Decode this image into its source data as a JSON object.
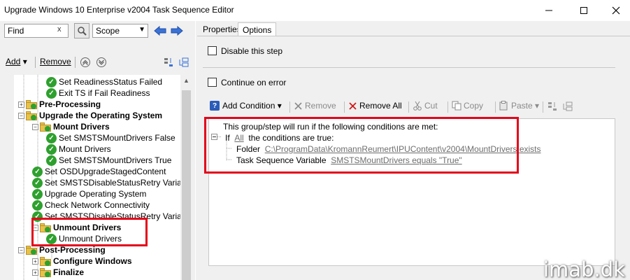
{
  "window": {
    "title": "Upgrade Windows 10 Enterprise v2004 Task Sequence Editor"
  },
  "search": {
    "value": "Find",
    "clear": "x",
    "scope": "Scope"
  },
  "tree_toolbar": {
    "add": "Add",
    "remove": "Remove"
  },
  "tree": [
    {
      "label": "Set ReadinessStatus Failed",
      "type": "step"
    },
    {
      "label": "Exit TS if Fail Readiness",
      "type": "step"
    },
    {
      "label": "Pre-Processing",
      "type": "group",
      "exp": "+"
    },
    {
      "label": "Upgrade the Operating System",
      "type": "group",
      "exp": "−"
    },
    {
      "label": "Mount Drivers",
      "type": "group",
      "exp": "−"
    },
    {
      "label": "Set SMSTSMountDrivers False",
      "type": "step"
    },
    {
      "label": "Mount Drivers",
      "type": "step"
    },
    {
      "label": "Set SMSTSMountDrivers True",
      "type": "step"
    },
    {
      "label": "Set OSDUpgradeStagedContent",
      "type": "step"
    },
    {
      "label": "Set SMSTSDisableStatusRetry Varia",
      "type": "step"
    },
    {
      "label": "Upgrade Operating System",
      "type": "step"
    },
    {
      "label": "Check Network Connectivity",
      "type": "step"
    },
    {
      "label": "Set SMSTSDisableStatusRetry Varia",
      "type": "step"
    },
    {
      "label": "Unmount Drivers",
      "type": "group",
      "exp": "−"
    },
    {
      "label": "Unmount Drivers",
      "type": "step"
    },
    {
      "label": "Post-Processing",
      "type": "group",
      "exp": "−"
    },
    {
      "label": "Configure Windows",
      "type": "group",
      "exp": "+"
    },
    {
      "label": "Finalize",
      "type": "group",
      "exp": "+"
    }
  ],
  "tabs": {
    "properties": "Properties",
    "options": "Options"
  },
  "options": {
    "disable_step": "Disable this step",
    "continue_on_error": "Continue on error"
  },
  "cond_toolbar": {
    "add_condition": "Add Condition",
    "remove": "Remove",
    "remove_all": "Remove All",
    "cut": "Cut",
    "copy": "Copy",
    "paste": "Paste"
  },
  "conditions": {
    "intro": "This group/step will run if the following conditions are met:",
    "if_prefix": "If",
    "if_link": "All",
    "if_suffix": "the conditions are true:",
    "folder_label": "Folder",
    "folder_value": "C:\\ProgramData\\KromannReumert\\IPUContent\\v2004\\MountDrivers exists",
    "tsvar_label": "Task Sequence Variable",
    "tsvar_value": "SMSTSMountDrivers equals \"True\""
  },
  "watermark": "imab.dk",
  "colors": {
    "highlight_box": "#e3061b",
    "step_check": "#2ea02e",
    "folder": "#e8c14a"
  }
}
